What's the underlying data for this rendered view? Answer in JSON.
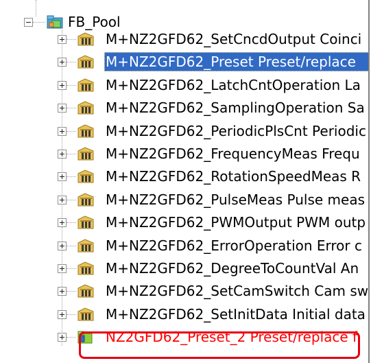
{
  "tree": {
    "root": {
      "label": "FB_Pool",
      "expander": "-",
      "icon": "fb-pool-folder-icon"
    },
    "items": [
      {
        "label": "M+NZ2GFD62_SetCncdOutput Coinci",
        "expander": "+",
        "icon": "fb-library-icon",
        "selected": false,
        "highlight": false
      },
      {
        "label": "M+NZ2GFD62_Preset Preset/replace",
        "expander": "+",
        "icon": "fb-library-icon",
        "selected": true,
        "highlight": false
      },
      {
        "label": "M+NZ2GFD62_LatchCntOperation La",
        "expander": "+",
        "icon": "fb-library-icon",
        "selected": false,
        "highlight": false
      },
      {
        "label": "M+NZ2GFD62_SamplingOperation Sa",
        "expander": "+",
        "icon": "fb-library-icon",
        "selected": false,
        "highlight": false
      },
      {
        "label": "M+NZ2GFD62_PeriodicPlsCnt Periodic",
        "expander": "+",
        "icon": "fb-library-icon",
        "selected": false,
        "highlight": false
      },
      {
        "label": "M+NZ2GFD62_FrequencyMeas Frequ",
        "expander": "+",
        "icon": "fb-library-icon",
        "selected": false,
        "highlight": false
      },
      {
        "label": "M+NZ2GFD62_RotationSpeedMeas R",
        "expander": "+",
        "icon": "fb-library-icon",
        "selected": false,
        "highlight": false
      },
      {
        "label": "M+NZ2GFD62_PulseMeas Pulse meas",
        "expander": "+",
        "icon": "fb-library-icon",
        "selected": false,
        "highlight": false
      },
      {
        "label": "M+NZ2GFD62_PWMOutput PWM outp",
        "expander": "+",
        "icon": "fb-library-icon",
        "selected": false,
        "highlight": false
      },
      {
        "label": "M+NZ2GFD62_ErrorOperation Error c",
        "expander": "+",
        "icon": "fb-library-icon",
        "selected": false,
        "highlight": false
      },
      {
        "label": "M+NZ2GFD62_DegreeToCountVal An",
        "expander": "+",
        "icon": "fb-library-icon",
        "selected": false,
        "highlight": false
      },
      {
        "label": "M+NZ2GFD62_SetCamSwitch Cam sw",
        "expander": "+",
        "icon": "fb-library-icon",
        "selected": false,
        "highlight": false
      },
      {
        "label": "M+NZ2GFD62_SetInitData Initial data",
        "expander": "+",
        "icon": "fb-library-icon",
        "selected": false,
        "highlight": false
      },
      {
        "label": "NZ2GFD62_Preset_2 Preset/replace f",
        "expander": "+",
        "icon": "fb-user-folder-icon",
        "selected": false,
        "highlight": true
      }
    ]
  },
  "colors": {
    "selection": "#316ac5",
    "highlight_text": "#ff0000",
    "highlight_box": "#e60012"
  }
}
